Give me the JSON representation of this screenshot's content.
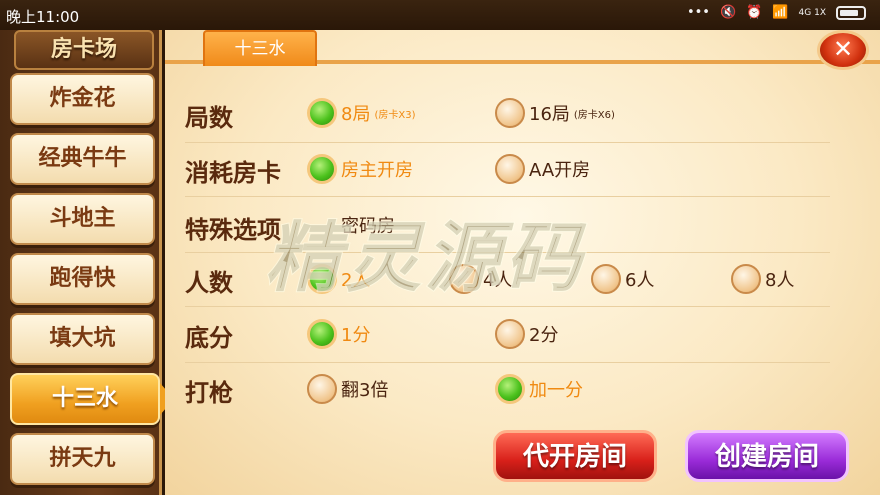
{
  "status_bar": {
    "time": "晚上11:00",
    "network": "4G 1X"
  },
  "sidebar": {
    "title": "房卡场",
    "items": [
      {
        "label": "炸金花"
      },
      {
        "label": "经典牛牛"
      },
      {
        "label": "斗地主"
      },
      {
        "label": "跑得快"
      },
      {
        "label": "填大坑"
      },
      {
        "label": "十三水"
      },
      {
        "label": "拼天九"
      }
    ],
    "active_index": 5
  },
  "tab": {
    "label": "十三水"
  },
  "close": {
    "label": "✕"
  },
  "rows": [
    {
      "label": "局数",
      "options": [
        {
          "text": "8局",
          "sub": "(房卡X3)",
          "selected": true
        },
        {
          "text": "16局",
          "sub": "(房卡X6)",
          "selected": false
        }
      ]
    },
    {
      "label": "消耗房卡",
      "options": [
        {
          "text": "房主开房",
          "selected": true
        },
        {
          "text": "AA开房",
          "selected": false
        }
      ]
    },
    {
      "label": "特殊选项",
      "options": [
        {
          "text": "密码房",
          "selected": false
        }
      ]
    },
    {
      "label": "人数",
      "options": [
        {
          "text": "2人",
          "selected": true
        },
        {
          "text": "4人",
          "selected": false
        },
        {
          "text": "6人",
          "selected": false
        },
        {
          "text": "8人",
          "selected": false
        }
      ]
    },
    {
      "label": "底分",
      "options": [
        {
          "text": "1分",
          "selected": true
        },
        {
          "text": "2分",
          "selected": false
        }
      ]
    },
    {
      "label": "打枪",
      "options": [
        {
          "text": "翻3倍",
          "selected": false
        },
        {
          "text": "加一分",
          "selected": true
        }
      ]
    }
  ],
  "buttons": {
    "proxy_open": "代开房间",
    "create_room": "创建房间"
  },
  "watermark": "精灵源码",
  "colors": {
    "selected_text": "#f08a12",
    "radio_on": "#4cc21d",
    "red_button": "#d8201a",
    "purple_button": "#9a2bd8"
  }
}
